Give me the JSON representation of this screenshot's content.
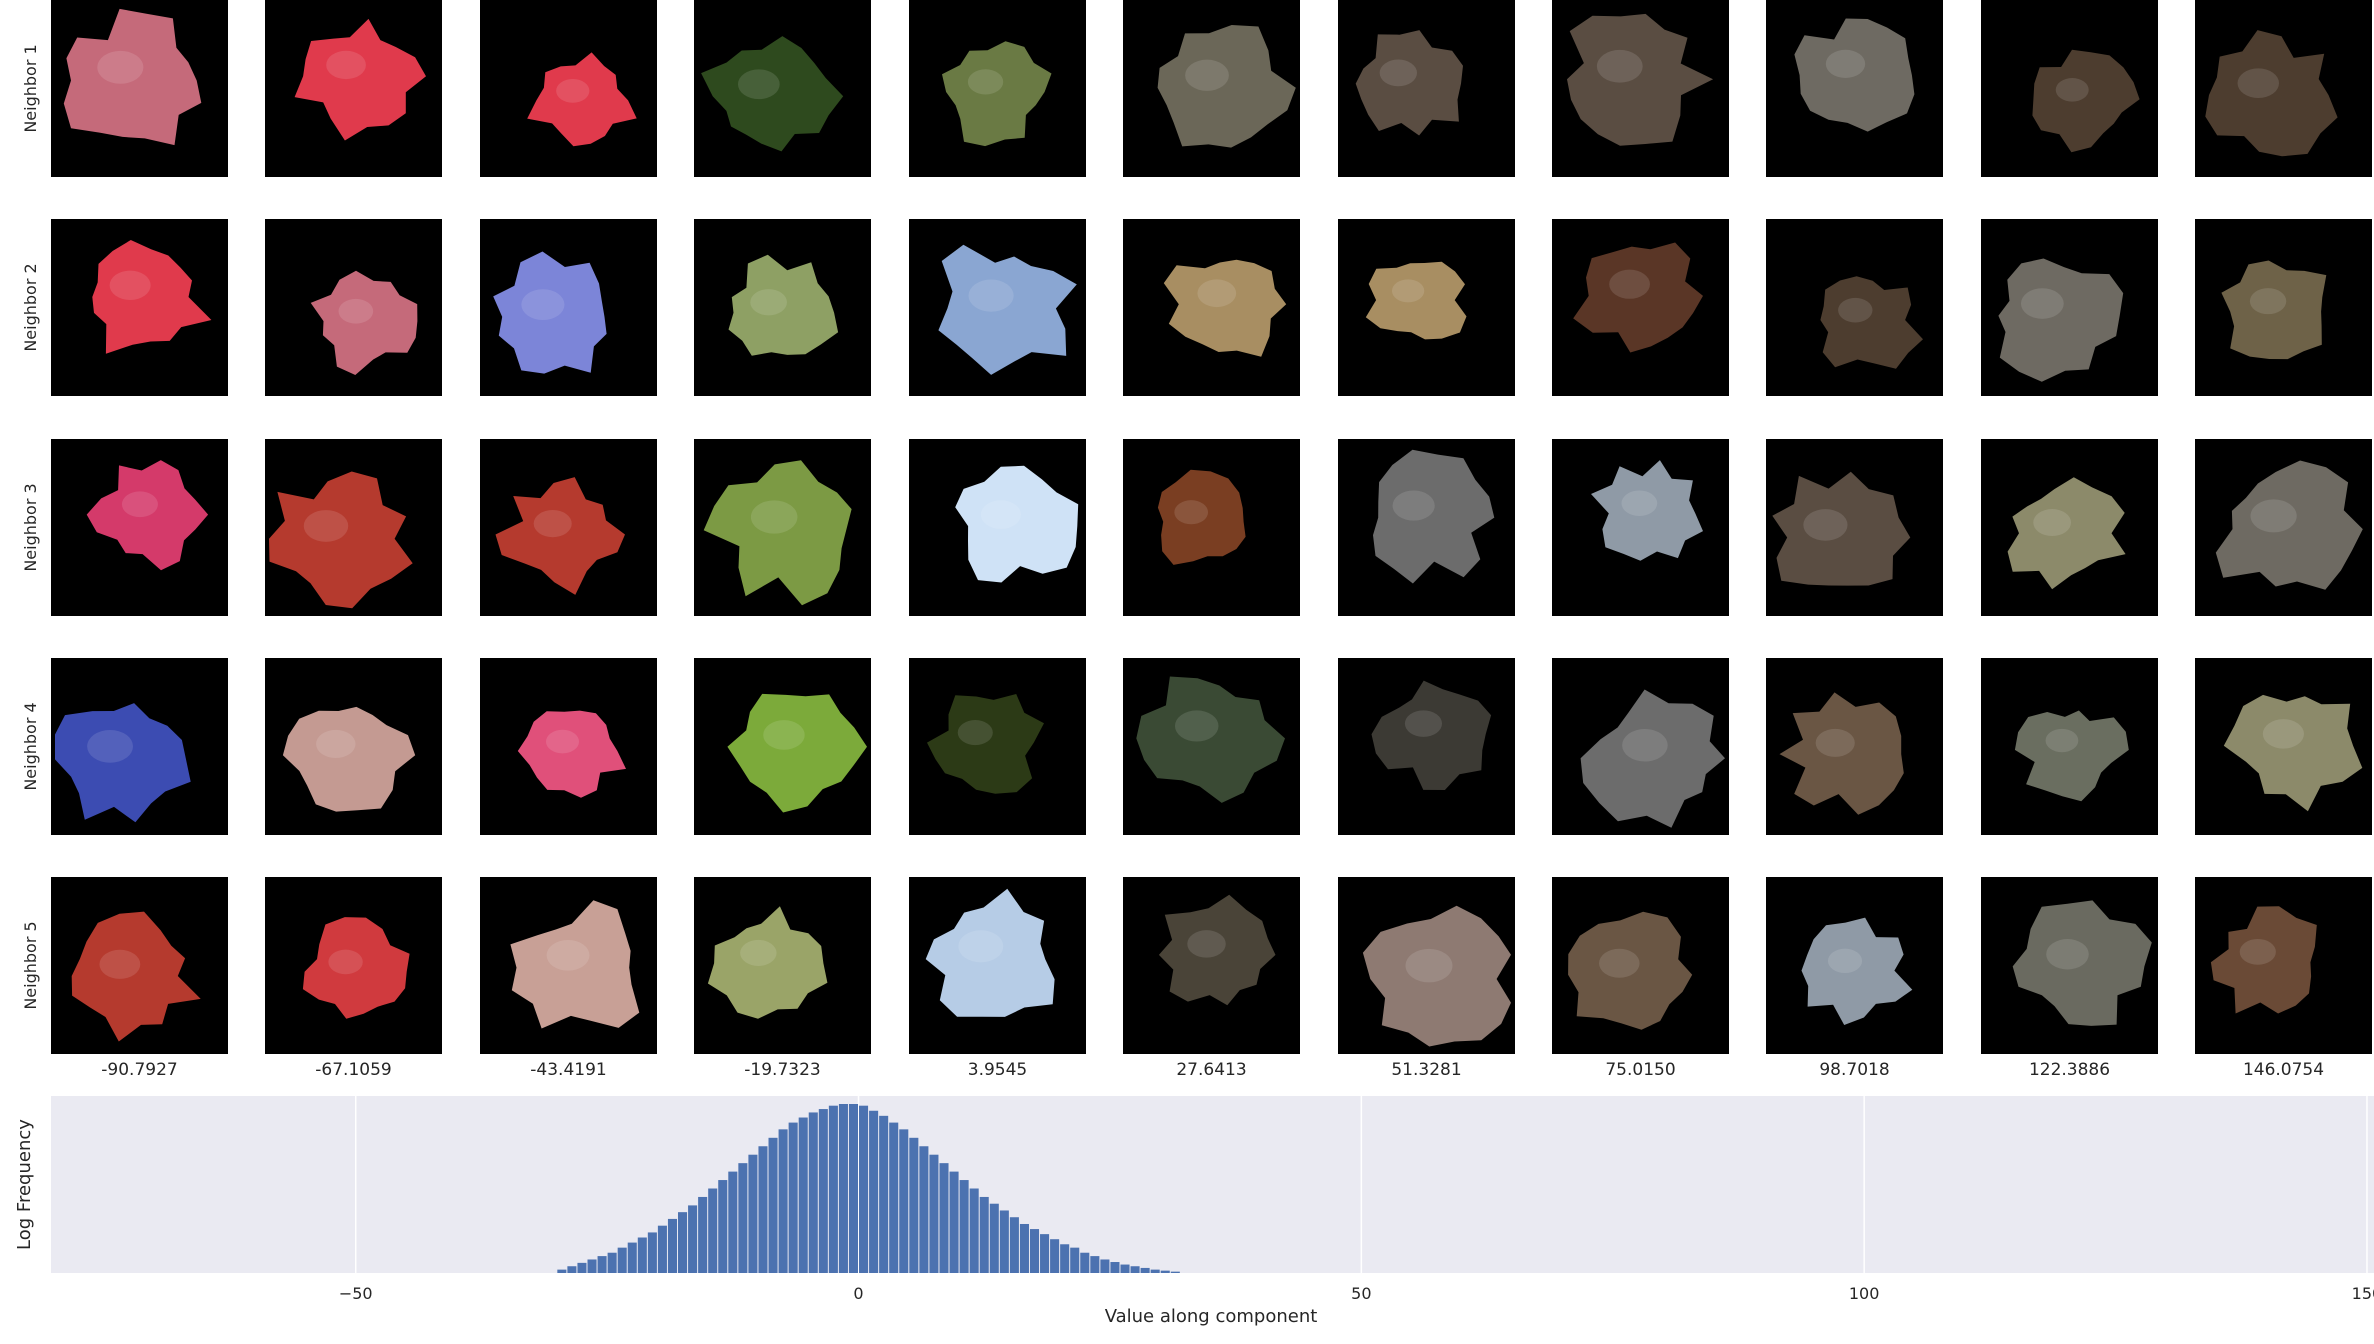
{
  "chart_data": {
    "type": "bar",
    "image_grid": {
      "row_labels": [
        "Neighbor 1",
        "Neighbor 2",
        "Neighbor 3",
        "Neighbor 4",
        "Neighbor 5"
      ],
      "column_labels": [
        "-90.7927",
        "-67.1059",
        "-43.4191",
        "-19.7323",
        "3.9545",
        "27.6413",
        "51.3281",
        "75.0150",
        "98.7018",
        "122.3886",
        "146.0754"
      ],
      "tile_colors": [
        [
          "#c56a7a",
          "#e03a4c",
          "#e03a4c",
          "#2e4a1e",
          "#6a7a44",
          "#6b6758",
          "#5a4d42",
          "#5a4d42",
          "#6e6a62",
          "#4d3d2f",
          "#4d3d2f"
        ],
        [
          "#e03a4c",
          "#c56a7a",
          "#7c85d8",
          "#8ea064",
          "#8aa6d2",
          "#a88e62",
          "#a88e62",
          "#5a3626",
          "#4d3d2f",
          "#6e6a62",
          "#6e6248"
        ],
        [
          "#d43a6a",
          "#b53a2e",
          "#b53a2e",
          "#7c9a44",
          "#cfe2f6",
          "#7a3e22",
          "#6c6c6c",
          "#8f9aa6",
          "#5a4d42",
          "#8c8a6a",
          "#6e6a62"
        ],
        [
          "#3c4cb2",
          "#c49a92",
          "#e0507a",
          "#7caa3a",
          "#2c3a16",
          "#3a4a34",
          "#3c3a34",
          "#6c6c6c",
          "#6a5644",
          "#6a6e60",
          "#8c8a6a"
        ],
        [
          "#b53a2e",
          "#d03a3e",
          "#c8a096",
          "#9aa468",
          "#b6cce6",
          "#4a4438",
          "#8e7a72",
          "#6a5644",
          "#8f9aa6",
          "#6a6a60",
          "#6a4a36"
        ]
      ]
    },
    "histogram": {
      "xlabel": "Value along component",
      "ylabel": "Log Frequency",
      "xlim": [
        -80.3,
        150.7
      ],
      "xticks": [
        -50,
        0,
        50,
        100,
        150
      ],
      "xtick_labels": [
        "−50",
        "0",
        "50",
        "100",
        "150"
      ],
      "bin_width": 1.0,
      "log_values": [
        0.02,
        0.04,
        0.06,
        0.08,
        0.1,
        0.12,
        0.15,
        0.18,
        0.21,
        0.24,
        0.28,
        0.32,
        0.36,
        0.4,
        0.45,
        0.5,
        0.55,
        0.6,
        0.65,
        0.7,
        0.75,
        0.8,
        0.85,
        0.89,
        0.92,
        0.95,
        0.97,
        0.99,
        1.0,
        1.0,
        0.99,
        0.96,
        0.93,
        0.89,
        0.85,
        0.8,
        0.75,
        0.7,
        0.65,
        0.6,
        0.55,
        0.5,
        0.45,
        0.41,
        0.37,
        0.33,
        0.29,
        0.26,
        0.23,
        0.2,
        0.17,
        0.15,
        0.12,
        0.1,
        0.08,
        0.065,
        0.05,
        0.04,
        0.03,
        0.02,
        0.014,
        0.008
      ],
      "bin_start": -30.0,
      "bar_color": "#4c72b0",
      "background": "#eaeaf2",
      "grid": true
    }
  }
}
